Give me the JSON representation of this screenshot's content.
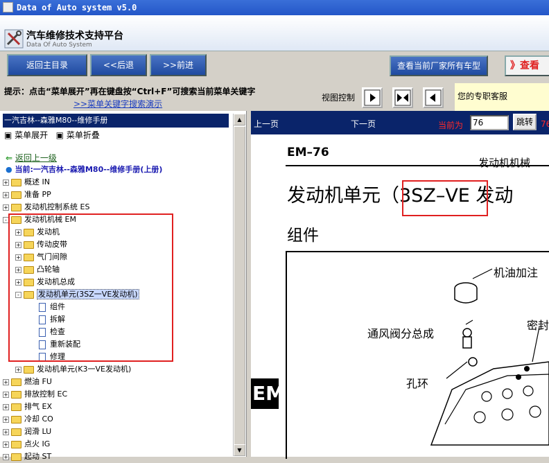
{
  "window": {
    "title": "Data of Auto system v5.0"
  },
  "header": {
    "title_cn": "汽车维修技术支持平台",
    "title_en": "Data Of Auto System"
  },
  "toolbar": {
    "home_label": "返回主目录",
    "back_label": "<<后退",
    "forward_label": ">>前进",
    "all_models_label": "查看当前厂家所有车型",
    "view_label": "》查看"
  },
  "hint": {
    "text": "提示：点击“菜单展开”再在键盘按“Ctrl+F”可搜索当前菜单关键字",
    "demo_link": ">>菜单关键字搜索演示",
    "view_control": "视图控制"
  },
  "service": {
    "text": "您的专职客服"
  },
  "left": {
    "breadcrumb": "一汽吉林--森雅M80--维修手册",
    "expand": "菜单展开",
    "collapse": "菜单折叠",
    "back_up": "返回上一级",
    "current": "当前:一汽吉林--森雅M80--维修手册(上册)"
  },
  "tree": [
    {
      "label": "概述 IN",
      "pm": "+"
    },
    {
      "label": "准备 PP",
      "pm": "+"
    },
    {
      "label": "发动机控制系统 ES",
      "pm": "+"
    },
    {
      "label": "发动机机械 EM",
      "pm": "-"
    },
    {
      "label": "发动机",
      "pm": "+"
    },
    {
      "label": "传动皮带",
      "pm": "+"
    },
    {
      "label": "气门间隙",
      "pm": "+"
    },
    {
      "label": "凸轮轴",
      "pm": "+"
    },
    {
      "label": "发动机总成",
      "pm": "+"
    },
    {
      "label": "发动机单元(3SZ一VE发动机)",
      "pm": "-"
    },
    {
      "label": "组件"
    },
    {
      "label": "拆解"
    },
    {
      "label": "检查"
    },
    {
      "label": "重新装配"
    },
    {
      "label": "修理"
    },
    {
      "label": "发动机单元(K3一VE发动机)",
      "pm": "+"
    },
    {
      "label": "燃油 FU",
      "pm": "+"
    },
    {
      "label": "排放控制 EC",
      "pm": "+"
    },
    {
      "label": "排气 EX",
      "pm": "+"
    },
    {
      "label": "冷却 CO",
      "pm": "+"
    },
    {
      "label": "润滑 LU",
      "pm": "+"
    },
    {
      "label": "点火 IG",
      "pm": "+"
    },
    {
      "label": "起动 ST",
      "pm": "+"
    }
  ],
  "nav": {
    "prev_label": "上一页",
    "next_label": "下一页",
    "current_label": "当前为",
    "page_value": "76",
    "jump_label": "跳转",
    "page_tail": "76"
  },
  "doc": {
    "code": "EM–76",
    "section": "发动机机械",
    "title": "发动机单元（3SZ–VE 发动",
    "subtitle": "组件",
    "label_oil_cap": "机油加注",
    "label_pcv": "通风阀分总成",
    "label_seal": "密封",
    "label_ring": "孔环",
    "side_tab": "EM"
  },
  "colors": {
    "highlight": "#e02020",
    "crumb_bg": "#0a246a",
    "toolbar_btn": "#2a56b0"
  }
}
